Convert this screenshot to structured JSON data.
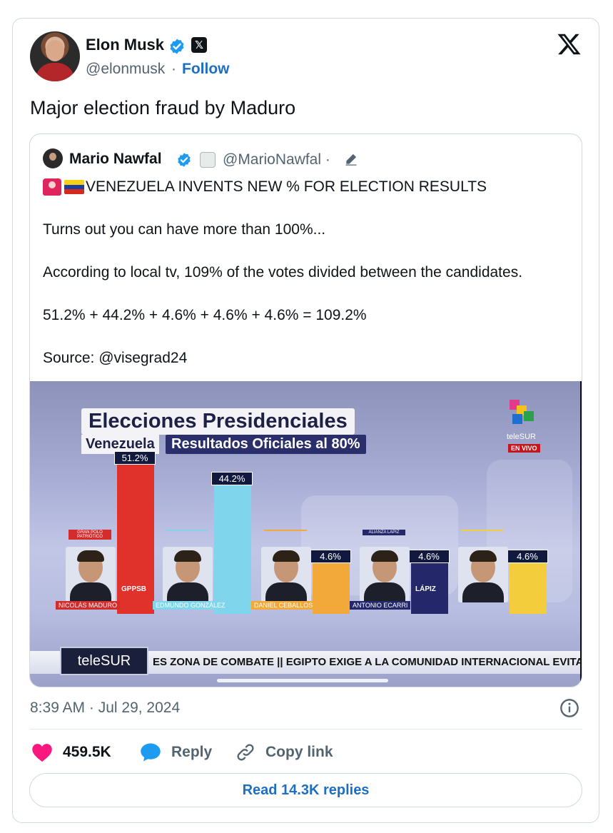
{
  "author": {
    "name": "Elon Musk",
    "handle": "@elonmusk",
    "separator": "·",
    "follow_label": "Follow",
    "verified_color": "#1d9bf0",
    "badge_icon": "x-affiliate-badge-icon"
  },
  "tweet": {
    "text": "Major election fraud by Maduro",
    "timestamp": "8:39 AM · Jul 29, 2024"
  },
  "quoted": {
    "name": "Mario Nawfal",
    "handle": "@MarioNawfal",
    "separator": "·",
    "headline": "VENEZUELA INVENTS NEW % FOR ELECTION RESULTS",
    "lines": [
      "Turns out you can have more than 100%...",
      "According to local tv, 109% of the votes divided between the candidates.",
      "51.2% + 44.2% + 4.6% + 4.6% + 4.6% = 109.2%",
      "Source: @visegrad24"
    ],
    "image": {
      "title": "Elecciones Presidenciales",
      "country": "Venezuela",
      "results": "Resultados Oficiales al 80%",
      "channel": "teleSUR",
      "live": "EN VIVO",
      "ticker_logo": "teleSUR",
      "ticker": "ES ZONA DE COMBATE  ||  EGIPTO EXIGE A LA COMUNIDAD INTERNACIONAL EVITAR",
      "candidates": [
        {
          "name": "NICOLÁS MADURO",
          "party": "GRAN POLO PATRIÓTICO",
          "party_logo": "GPPSB",
          "percent": "51.2%",
          "value": 51.2,
          "bar_color": "#e0312a",
          "party_color": "#d42b2b"
        },
        {
          "name": "EDMUNDO GONZÁLEZ",
          "party": "",
          "party_logo": "",
          "percent": "44.2%",
          "value": 44.2,
          "bar_color": "#7fd6ec",
          "party_color": "#7fd6ec"
        },
        {
          "name": "DANIEL CEBALLOS",
          "party": "",
          "party_logo": "",
          "percent": "4.6%",
          "value": 4.6,
          "bar_color": "#f2a93a",
          "party_color": "#f2a93a"
        },
        {
          "name": "ANTONIO ECARRI",
          "party": "ALIANZA LAPIZ",
          "party_logo": "LÁPIZ",
          "percent": "4.6%",
          "value": 4.6,
          "bar_color": "#24286b",
          "party_color": "#24286b"
        },
        {
          "name": "",
          "party": "",
          "party_logo": "",
          "percent": "4.6%",
          "value": 4.6,
          "bar_color": "#f4cd3c",
          "party_color": "#f4cd3c"
        }
      ]
    }
  },
  "actions": {
    "likes": "459.5K",
    "reply": "Reply",
    "copy_link": "Copy link",
    "read_replies": "Read 14.3K replies",
    "like_color": "#f91880",
    "reply_color": "#1d9bf0"
  }
}
